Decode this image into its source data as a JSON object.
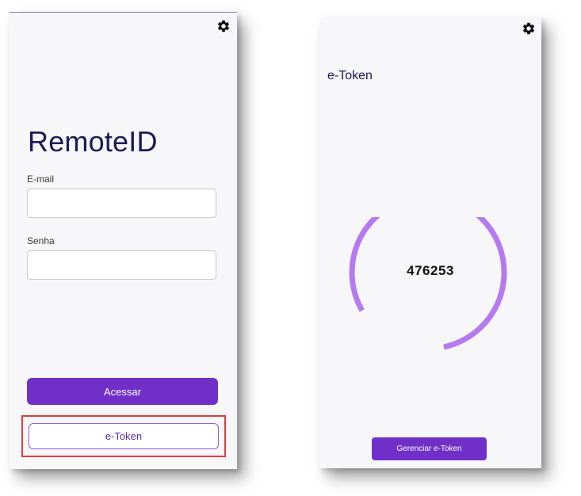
{
  "login": {
    "app_title": "RemoteID",
    "email_label": "E-mail",
    "email_value": "",
    "password_label": "Senha",
    "password_value": "",
    "access_button": "Acessar",
    "etoken_button": "e-Token",
    "settings_icon": "gear-icon"
  },
  "etoken": {
    "title": "e-Token",
    "code": "476253",
    "manage_button": "Gerenciar e-Token",
    "settings_icon": "gear-icon",
    "progress_fraction": 0.8
  },
  "colors": {
    "primary": "#7030c8",
    "title_text": "#1c1a55",
    "ring": "#b57af0",
    "highlight": "#e53a3a",
    "screen_bg": "#f7f6f8"
  }
}
